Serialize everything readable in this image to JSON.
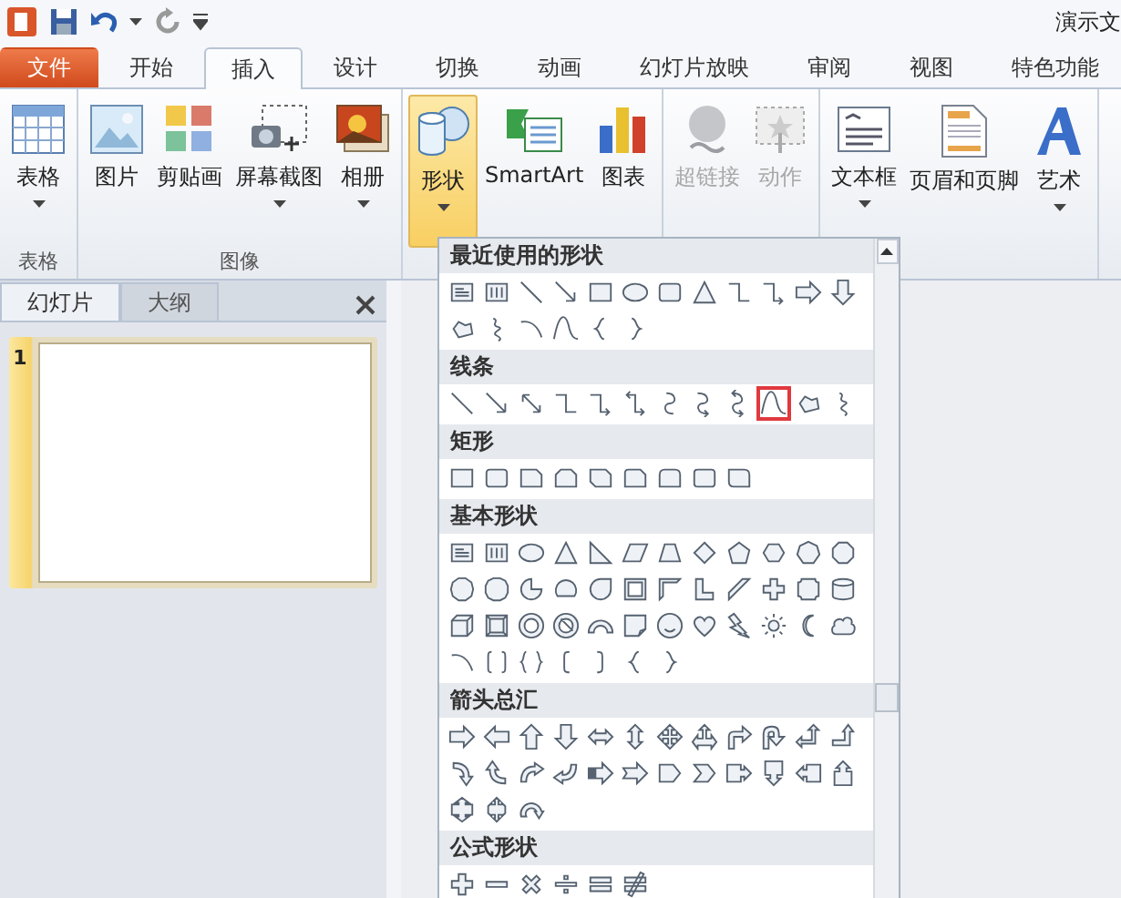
{
  "window": {
    "title": "演示文"
  },
  "menu_tabs": [
    {
      "label": "文件",
      "kind": "file",
      "selected": false
    },
    {
      "label": "开始",
      "kind": "tab",
      "selected": false
    },
    {
      "label": "插入",
      "kind": "tab",
      "selected": true
    },
    {
      "label": "设计",
      "kind": "tab",
      "selected": false
    },
    {
      "label": "切换",
      "kind": "tab",
      "selected": false
    },
    {
      "label": "动画",
      "kind": "tab",
      "selected": false
    },
    {
      "label": "幻灯片放映",
      "kind": "tab",
      "selected": false
    },
    {
      "label": "审阅",
      "kind": "tab",
      "selected": false
    },
    {
      "label": "视图",
      "kind": "tab",
      "selected": false
    },
    {
      "label": "特色功能",
      "kind": "tab",
      "selected": false
    }
  ],
  "ribbon_groups": [
    {
      "label": "表格",
      "buttons": [
        {
          "label": "表格",
          "dropdown": true,
          "disabled": false,
          "selected": false
        }
      ]
    },
    {
      "label": "图像",
      "buttons": [
        {
          "label": "图片",
          "dropdown": false,
          "disabled": false,
          "selected": false
        },
        {
          "label": "剪贴画",
          "dropdown": false,
          "disabled": false,
          "selected": false
        },
        {
          "label": "屏幕截图",
          "dropdown": true,
          "disabled": false,
          "selected": false
        },
        {
          "label": "相册",
          "dropdown": true,
          "disabled": false,
          "selected": false
        }
      ]
    },
    {
      "buttons": [
        {
          "label": "形状",
          "dropdown": true,
          "disabled": false,
          "selected": true
        },
        {
          "label": "SmartArt",
          "dropdown": false,
          "disabled": false,
          "selected": false
        },
        {
          "label": "图表",
          "dropdown": false,
          "disabled": false,
          "selected": false
        }
      ]
    },
    {
      "buttons": [
        {
          "label": "超链接",
          "dropdown": false,
          "disabled": true,
          "selected": false
        },
        {
          "label": "动作",
          "dropdown": false,
          "disabled": true,
          "selected": false
        }
      ]
    },
    {
      "buttons": [
        {
          "label": "文本框",
          "dropdown": true,
          "disabled": false,
          "selected": false
        },
        {
          "label": "页眉和页脚",
          "dropdown": false,
          "disabled": false,
          "selected": false
        },
        {
          "label": "艺术",
          "dropdown": true,
          "disabled": false,
          "selected": false
        }
      ]
    }
  ],
  "slides_pane": {
    "tabs": [
      {
        "label": "幻灯片",
        "selected": true
      },
      {
        "label": "大纲",
        "selected": false
      }
    ],
    "slides": [
      {
        "number": "1",
        "selected": true
      }
    ]
  },
  "shapes_menu": {
    "sections": [
      {
        "title": "最近使用的形状",
        "shapes": [
          {
            "kind": "textbox",
            "selected": false
          },
          {
            "kind": "vtextbox",
            "selected": false
          },
          {
            "kind": "line",
            "selected": false
          },
          {
            "kind": "arrow",
            "selected": false
          },
          {
            "kind": "rect",
            "selected": false
          },
          {
            "kind": "ellipse",
            "selected": false
          },
          {
            "kind": "roundrect",
            "selected": false
          },
          {
            "kind": "triangle",
            "selected": false
          },
          {
            "kind": "elbow",
            "selected": false
          },
          {
            "kind": "elbowarrow",
            "selected": false
          },
          {
            "kind": "rightarrow",
            "selected": false
          },
          {
            "kind": "downarrow",
            "selected": false
          },
          {
            "kind": "freeform",
            "selected": false
          },
          {
            "kind": "scribble",
            "selected": false
          },
          {
            "kind": "arc",
            "selected": false
          },
          {
            "kind": "curve",
            "selected": false
          },
          {
            "kind": "lbrace",
            "selected": false
          },
          {
            "kind": "rbrace",
            "selected": false
          }
        ]
      },
      {
        "title": "线条",
        "shapes": [
          {
            "kind": "line",
            "selected": false
          },
          {
            "kind": "arrow",
            "selected": false
          },
          {
            "kind": "dblarrow",
            "selected": false
          },
          {
            "kind": "elbow",
            "selected": false
          },
          {
            "kind": "elbowarrow",
            "selected": false
          },
          {
            "kind": "elbowdbl",
            "selected": false
          },
          {
            "kind": "curvedconn",
            "selected": false
          },
          {
            "kind": "curvedconnarrow",
            "selected": false
          },
          {
            "kind": "curvedconndbl",
            "selected": false
          },
          {
            "kind": "curve",
            "selected": true
          },
          {
            "kind": "freeform",
            "selected": false
          },
          {
            "kind": "scribble",
            "selected": false
          }
        ]
      },
      {
        "title": "矩形",
        "shapes": [
          {
            "kind": "rect",
            "selected": false
          },
          {
            "kind": "roundrect",
            "selected": false
          },
          {
            "kind": "snip",
            "selected": false
          },
          {
            "kind": "snip2",
            "selected": false
          },
          {
            "kind": "snipdiag",
            "selected": false
          },
          {
            "kind": "snipround",
            "selected": false
          },
          {
            "kind": "roundtop",
            "selected": false
          },
          {
            "kind": "roundrect",
            "selected": false
          },
          {
            "kind": "rounddiag",
            "selected": false
          }
        ]
      },
      {
        "title": "基本形状",
        "shapes": [
          {
            "kind": "textbox",
            "selected": false
          },
          {
            "kind": "vtextbox",
            "selected": false
          },
          {
            "kind": "ellipse",
            "selected": false
          },
          {
            "kind": "triangle",
            "selected": false
          },
          {
            "kind": "rtriangle",
            "selected": false
          },
          {
            "kind": "parallelogram",
            "selected": false
          },
          {
            "kind": "trapezoid",
            "selected": false
          },
          {
            "kind": "diamond",
            "selected": false
          },
          {
            "kind": "pentagon",
            "selected": false
          },
          {
            "kind": "hexagon",
            "selected": false
          },
          {
            "kind": "heptagon",
            "selected": false
          },
          {
            "kind": "octagon",
            "selected": false
          },
          {
            "kind": "decagon",
            "selected": false
          },
          {
            "kind": "dodecagon",
            "selected": false
          },
          {
            "kind": "pie",
            "selected": false
          },
          {
            "kind": "chord",
            "selected": false
          },
          {
            "kind": "teardrop",
            "selected": false
          },
          {
            "kind": "frame",
            "selected": false
          },
          {
            "kind": "halfframe",
            "selected": false
          },
          {
            "kind": "lshape",
            "selected": false
          },
          {
            "kind": "diagstripe",
            "selected": false
          },
          {
            "kind": "cross",
            "selected": false
          },
          {
            "kind": "plaque",
            "selected": false
          },
          {
            "kind": "can",
            "selected": false
          },
          {
            "kind": "cube",
            "selected": false
          },
          {
            "kind": "bevel",
            "selected": false
          },
          {
            "kind": "donut",
            "selected": false
          },
          {
            "kind": "nosymbol",
            "selected": false
          },
          {
            "kind": "blockarc",
            "selected": false
          },
          {
            "kind": "foldedcorner",
            "selected": false
          },
          {
            "kind": "smiley",
            "selected": false
          },
          {
            "kind": "heart",
            "selected": false
          },
          {
            "kind": "lightning",
            "selected": false
          },
          {
            "kind": "sun",
            "selected": false
          },
          {
            "kind": "moon",
            "selected": false
          },
          {
            "kind": "cloud",
            "selected": false
          },
          {
            "kind": "arc",
            "selected": false
          },
          {
            "kind": "bracketpair",
            "selected": false
          },
          {
            "kind": "bracepair",
            "selected": false
          },
          {
            "kind": "lbracket",
            "selected": false
          },
          {
            "kind": "rbracket",
            "selected": false
          },
          {
            "kind": "lbrace",
            "selected": false
          },
          {
            "kind": "rbrace",
            "selected": false
          }
        ]
      },
      {
        "title": "箭头总汇",
        "shapes": [
          {
            "kind": "rightarrow",
            "selected": false
          },
          {
            "kind": "leftarrow",
            "selected": false
          },
          {
            "kind": "uparrow",
            "selected": false
          },
          {
            "kind": "downarrow",
            "selected": false
          },
          {
            "kind": "leftrightarrow",
            "selected": false
          },
          {
            "kind": "updownarrow",
            "selected": false
          },
          {
            "kind": "quadarrow",
            "selected": false
          },
          {
            "kind": "leftrightuparrow",
            "selected": false
          },
          {
            "kind": "bentarrow",
            "selected": false
          },
          {
            "kind": "uturnarrow",
            "selected": false
          },
          {
            "kind": "leftuparrow",
            "selected": false
          },
          {
            "kind": "bentuparrow",
            "selected": false
          },
          {
            "kind": "curvedright",
            "selected": false
          },
          {
            "kind": "curvedleft",
            "selected": false
          },
          {
            "kind": "curvedup",
            "selected": false
          },
          {
            "kind": "curveddown",
            "selected": false
          },
          {
            "kind": "stripedarrow",
            "selected": false
          },
          {
            "kind": "notchedarrow",
            "selected": false
          },
          {
            "kind": "homeplate",
            "selected": false
          },
          {
            "kind": "chevron",
            "selected": false
          },
          {
            "kind": "rightcallout",
            "selected": false
          },
          {
            "kind": "downcallout",
            "selected": false
          },
          {
            "kind": "leftcallout",
            "selected": false
          },
          {
            "kind": "upcallout",
            "selected": false
          },
          {
            "kind": "leftrightcallout",
            "selected": false
          },
          {
            "kind": "quadcallout",
            "selected": false
          },
          {
            "kind": "circulararrow",
            "selected": false
          }
        ]
      },
      {
        "title": "公式形状",
        "shapes": [
          {
            "kind": "plus",
            "selected": false
          },
          {
            "kind": "minus",
            "selected": false
          },
          {
            "kind": "multiply",
            "selected": false
          },
          {
            "kind": "divide",
            "selected": false
          },
          {
            "kind": "equal",
            "selected": false
          },
          {
            "kind": "notequal",
            "selected": false
          }
        ]
      }
    ]
  }
}
